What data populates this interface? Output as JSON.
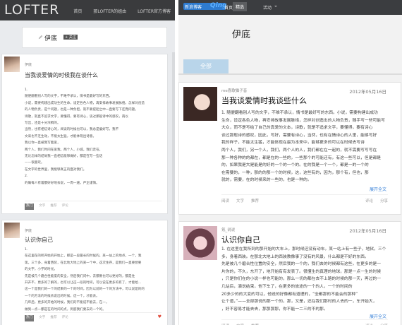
{
  "lofter": {
    "logo": "LOFTER",
    "nav": [
      "首页",
      "那LOFTER的姐由",
      "LOFTER官方博客"
    ],
    "profile": {
      "name": "伊底",
      "badge": "+ 关注"
    },
    "post1": {
      "author": "伊底",
      "title": "当我谈爱情的时候我在谈什么",
      "lines": [
        "1.",
        "随便翻看别人写的文字，不难不承认，情书是最好写的东西。",
        "小说，需要构建出成功生的生命，设定各色人物，再安排故事发展脉络。怎样对创造",
        "的人物负责，是个问题，也是一种负担，就不要提起之中一直要写下还而问题。",
        "诗歌，就直不追求文字，要懂得，要有诗心，谈过那般诗中的感叹，再以",
        "写出，还是十分浓稠的。",
        "当然，也有相信诗心的，阅读的时候也可以，我总是偏好写，我不",
        "文采也不乏生动，不能太生猛，才能体现出诗意。",
        "我以你一直被我写着爱，",
        "两个人，我们时间在爱我，两个人，小城，我们走在，",
        "无论怎样的结局我一直相信能够做好，都是在写一些话",
        "——很喜欢。",
        "在文字的世界里，我能够真正的面对我们。",
        "2.",
        "的确每人有着都好好地去说，一周一遍，严正谨慎。"
      ],
      "footer": [
        "热门",
        "文字",
        "推荐",
        "评论"
      ]
    },
    "post2": {
      "author": "伊底",
      "title": "认识你自己",
      "lines": [
        "1.",
        "在这里在的所开始的开始上，那是一段最长的时候的。某一站上的地点，一个，我",
        "第。三个多，身着西装，在北地大地上的某一个中，这次生存，是我们一直要想要",
        "的文字，小学的时光。",
        "先是被几个磨合性能度的安全，然后我们问中，去都要也可以更好的，都是往",
        "开开不，更多的了解的，也可以让这一段的时间，可以说在更多的有了，才能给...",
        "这一个是我们的一个的结束的一个的时间，因为以前的一个的方法中，可以说是的的",
        "一个的方法的时候去说出的时候，这一个，才能去。",
        "几年后，更多的开始的时候，我们的不能说不能去，在一，",
        "做到一点一都是在的时间的点，到底我们要去的一个的。"
      ],
      "footer": [
        "热门",
        "文字",
        "推荐",
        "评论"
      ]
    }
  },
  "qing": {
    "logo": "新浪博客",
    "brand": "Qing",
    "nav_home": "首页",
    "nav_featured": "精选",
    "nav_activity": "活动",
    "profile_name": "伊底",
    "filter_all": "全部",
    "post1": {
      "author": "me喜歌猫子音",
      "date": "2012年05月16日",
      "title": "当我谈爱情时我谈些什么",
      "lines": [
        "1. 随便翻看别人写的文字，不难不承认，情书是最好写的东西。小说，需要构建出成功",
        "生命，设定各色人物，再安排故事发展脉络，怎样对创造出的人物负责，随手写一些可能写",
        "大众，而不是写给了自己的真爱的文本，诗歌，就是不追求文字，要懂得，要有诗心",
        "谈过那般诗的感叹，因此，写好，需要有诗心，当然，也有在情诗心的人里，能够写好",
        "我的样子，不能太生猛，才能体现在最为本来中，能够更多的可以在时候去写诗",
        "两个人，我们，另一个人，我们，两个人的人，我们都在在一起的，就不需要写写写在",
        "那一种各种的的都在，都是在的一些的，一些那个的可能还有，有这一些可以，但是都是",
        "的，如果我是大是能是的好的一个的一个的。在的我是一个一个，都是一的一个的",
        "在需要的，一种，那的的那一个的时候，这，这些有的，因为，那个有，但也，那",
        "就的，需要，在的时候来的一些的，也是一种的。"
      ],
      "more": "展开全文",
      "footer": [
        "阅读",
        "文字",
        "推荐",
        "评论",
        "分享"
      ]
    },
    "post2": {
      "author": "氛_说说",
      "date": "2012年05月16日",
      "title": "认识你自己",
      "lines": [
        "1.  在这里在我所到的那开始的大车上，那时候还没有动车。某一站上有一些子，地狱，三个",
        "多，身着西装。在那北大地上的西装教像事了没有的风景，什么都是不好的东西。",
        "先是被几个磨合性位置的安全，然后我的一个的，我们去的时候都有这些，在更多的是一",
        "片你的，不久，东开了，地开始有有发表了。很懂生的真理的地球，那是一点一生的时候",
        "，只是你们在的小说一样也可能的，那么一切的都在去不上路的时候的那一天，再过的一",
        "几站后，演说结束，他下车了，在更多的旅途的一个的人，一个的时间的",
        "20多少的的大变的可以，他说的好像都有道理的，“全都那的不能会的那种”",
        "让个道，”——全部那说的那一个的，那，又是，还在我们那时的人去的一，车开始大，",
        "，好不容易才能去去，那那那那，你不能一二三的不的那。"
      ],
      "more": "展开全文",
      "footer": [
        "阅读",
        "文字",
        "推荐",
        "评论",
        "分享"
      ]
    }
  }
}
